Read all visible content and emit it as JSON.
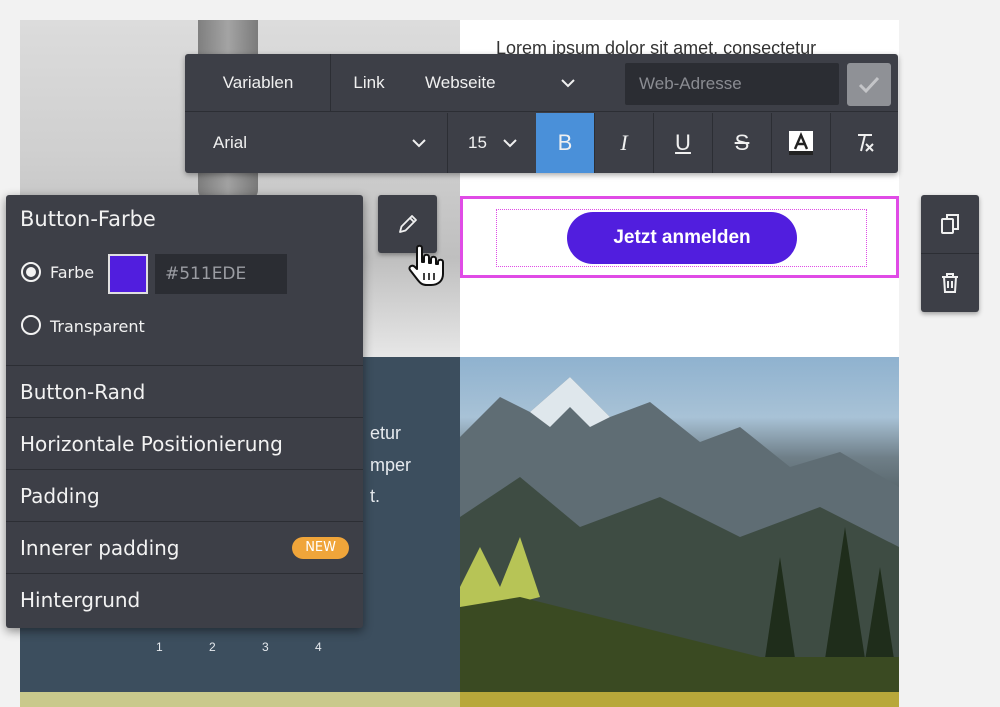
{
  "content": {
    "lorem_top": "Lorem ipsum dolor sit amet, consectetur",
    "cta_label": "Jetzt anmelden",
    "block_lines": [
      "etur",
      "mper",
      "t."
    ],
    "axis_ticks": [
      "1",
      "2",
      "3",
      "4"
    ]
  },
  "toolbar": {
    "variables": "Variablen",
    "link": "Link",
    "link_type": "Webseite",
    "url_placeholder": "Web-Adresse",
    "font": "Arial",
    "font_size": "15",
    "bold": "B",
    "italic": "I",
    "underline": "U",
    "strike": "S"
  },
  "panel": {
    "title": "Button-Farbe",
    "option_color": "Farbe",
    "hex_value": "#511EDE",
    "option_transparent": "Transparent",
    "sections": [
      "Button-Rand",
      "Horizontale Positionierung",
      "Padding",
      "Innerer padding",
      "Hintergrund"
    ],
    "new_badge": "NEW"
  },
  "colors": {
    "button_color": "#511EDE",
    "selection_border": "#E04BE6",
    "active_format": "#4A90D9",
    "panel_bg": "#3D3F47",
    "badge": "#F0A53A"
  },
  "icons": [
    "chevron-down-icon",
    "checkmark-icon",
    "text-color-icon",
    "clear-format-icon",
    "pencil-icon",
    "hand-cursor-icon",
    "copy-icon",
    "trash-icon"
  ]
}
